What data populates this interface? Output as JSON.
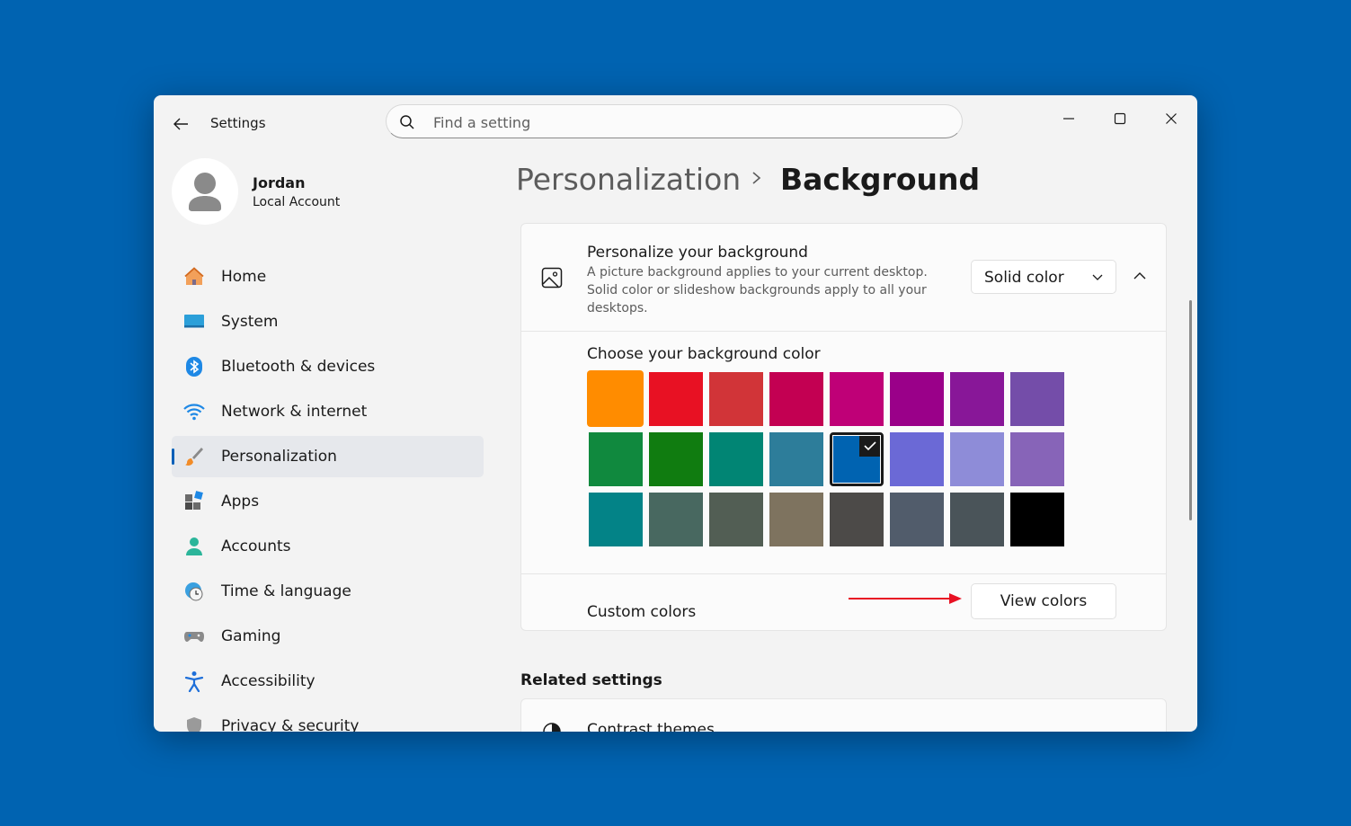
{
  "window": {
    "title": "Settings"
  },
  "search": {
    "placeholder": "Find a setting"
  },
  "user": {
    "name": "Jordan",
    "account_type": "Local Account"
  },
  "nav": {
    "items": [
      {
        "label": "Home",
        "icon": "home-icon"
      },
      {
        "label": "System",
        "icon": "system-icon"
      },
      {
        "label": "Bluetooth & devices",
        "icon": "bluetooth-icon"
      },
      {
        "label": "Network & internet",
        "icon": "wifi-icon"
      },
      {
        "label": "Personalization",
        "icon": "brush-icon",
        "active": true
      },
      {
        "label": "Apps",
        "icon": "apps-icon"
      },
      {
        "label": "Accounts",
        "icon": "accounts-icon"
      },
      {
        "label": "Time & language",
        "icon": "clock-globe-icon"
      },
      {
        "label": "Gaming",
        "icon": "gamepad-icon"
      },
      {
        "label": "Accessibility",
        "icon": "accessibility-icon"
      },
      {
        "label": "Privacy & security",
        "icon": "shield-icon"
      }
    ]
  },
  "breadcrumb": {
    "parent": "Personalization",
    "current": "Background"
  },
  "background": {
    "title": "Personalize your background",
    "description": "A picture background applies to your current desktop. Solid color or slideshow backgrounds apply to all your desktops.",
    "mode": "Solid color"
  },
  "colors": {
    "title": "Choose your background color",
    "rows": [
      [
        "#ff8c00",
        "#e81123",
        "#d13438",
        "#c30052",
        "#bf0077",
        "#9a0089",
        "#881798",
        "#744da9"
      ],
      [
        "#10893e",
        "#107c10",
        "#018574",
        "#2d7d9a",
        "#0063b1",
        "#6b69d6",
        "#8e8cd8",
        "#8764b8"
      ],
      [
        "#038387",
        "#486860",
        "#525e54",
        "#7e735f",
        "#4c4a48",
        "#515c6b",
        "#4a5459",
        "#000000"
      ]
    ],
    "selected": "#0063b1"
  },
  "custom_colors": {
    "label": "Custom colors",
    "button": "View colors"
  },
  "related": {
    "title": "Related settings",
    "first_item": "Contrast themes"
  },
  "theme": {
    "accent": "#005fb8",
    "desktop": "#0063b1",
    "annotation_arrow": "#e81123"
  }
}
